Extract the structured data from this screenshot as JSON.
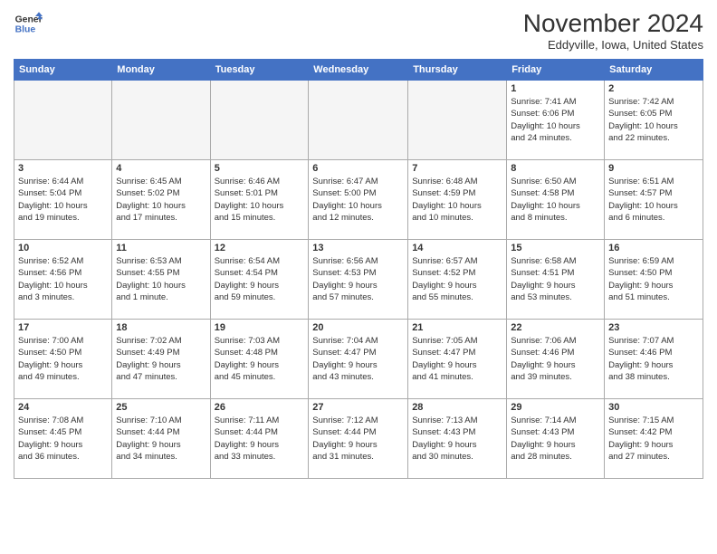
{
  "header": {
    "logo_line1": "General",
    "logo_line2": "Blue",
    "month": "November 2024",
    "location": "Eddyville, Iowa, United States"
  },
  "weekdays": [
    "Sunday",
    "Monday",
    "Tuesday",
    "Wednesday",
    "Thursday",
    "Friday",
    "Saturday"
  ],
  "weeks": [
    [
      {
        "day": "",
        "info": ""
      },
      {
        "day": "",
        "info": ""
      },
      {
        "day": "",
        "info": ""
      },
      {
        "day": "",
        "info": ""
      },
      {
        "day": "",
        "info": ""
      },
      {
        "day": "1",
        "info": "Sunrise: 7:41 AM\nSunset: 6:06 PM\nDaylight: 10 hours\nand 24 minutes."
      },
      {
        "day": "2",
        "info": "Sunrise: 7:42 AM\nSunset: 6:05 PM\nDaylight: 10 hours\nand 22 minutes."
      }
    ],
    [
      {
        "day": "3",
        "info": "Sunrise: 6:44 AM\nSunset: 5:04 PM\nDaylight: 10 hours\nand 19 minutes."
      },
      {
        "day": "4",
        "info": "Sunrise: 6:45 AM\nSunset: 5:02 PM\nDaylight: 10 hours\nand 17 minutes."
      },
      {
        "day": "5",
        "info": "Sunrise: 6:46 AM\nSunset: 5:01 PM\nDaylight: 10 hours\nand 15 minutes."
      },
      {
        "day": "6",
        "info": "Sunrise: 6:47 AM\nSunset: 5:00 PM\nDaylight: 10 hours\nand 12 minutes."
      },
      {
        "day": "7",
        "info": "Sunrise: 6:48 AM\nSunset: 4:59 PM\nDaylight: 10 hours\nand 10 minutes."
      },
      {
        "day": "8",
        "info": "Sunrise: 6:50 AM\nSunset: 4:58 PM\nDaylight: 10 hours\nand 8 minutes."
      },
      {
        "day": "9",
        "info": "Sunrise: 6:51 AM\nSunset: 4:57 PM\nDaylight: 10 hours\nand 6 minutes."
      }
    ],
    [
      {
        "day": "10",
        "info": "Sunrise: 6:52 AM\nSunset: 4:56 PM\nDaylight: 10 hours\nand 3 minutes."
      },
      {
        "day": "11",
        "info": "Sunrise: 6:53 AM\nSunset: 4:55 PM\nDaylight: 10 hours\nand 1 minute."
      },
      {
        "day": "12",
        "info": "Sunrise: 6:54 AM\nSunset: 4:54 PM\nDaylight: 9 hours\nand 59 minutes."
      },
      {
        "day": "13",
        "info": "Sunrise: 6:56 AM\nSunset: 4:53 PM\nDaylight: 9 hours\nand 57 minutes."
      },
      {
        "day": "14",
        "info": "Sunrise: 6:57 AM\nSunset: 4:52 PM\nDaylight: 9 hours\nand 55 minutes."
      },
      {
        "day": "15",
        "info": "Sunrise: 6:58 AM\nSunset: 4:51 PM\nDaylight: 9 hours\nand 53 minutes."
      },
      {
        "day": "16",
        "info": "Sunrise: 6:59 AM\nSunset: 4:50 PM\nDaylight: 9 hours\nand 51 minutes."
      }
    ],
    [
      {
        "day": "17",
        "info": "Sunrise: 7:00 AM\nSunset: 4:50 PM\nDaylight: 9 hours\nand 49 minutes."
      },
      {
        "day": "18",
        "info": "Sunrise: 7:02 AM\nSunset: 4:49 PM\nDaylight: 9 hours\nand 47 minutes."
      },
      {
        "day": "19",
        "info": "Sunrise: 7:03 AM\nSunset: 4:48 PM\nDaylight: 9 hours\nand 45 minutes."
      },
      {
        "day": "20",
        "info": "Sunrise: 7:04 AM\nSunset: 4:47 PM\nDaylight: 9 hours\nand 43 minutes."
      },
      {
        "day": "21",
        "info": "Sunrise: 7:05 AM\nSunset: 4:47 PM\nDaylight: 9 hours\nand 41 minutes."
      },
      {
        "day": "22",
        "info": "Sunrise: 7:06 AM\nSunset: 4:46 PM\nDaylight: 9 hours\nand 39 minutes."
      },
      {
        "day": "23",
        "info": "Sunrise: 7:07 AM\nSunset: 4:46 PM\nDaylight: 9 hours\nand 38 minutes."
      }
    ],
    [
      {
        "day": "24",
        "info": "Sunrise: 7:08 AM\nSunset: 4:45 PM\nDaylight: 9 hours\nand 36 minutes."
      },
      {
        "day": "25",
        "info": "Sunrise: 7:10 AM\nSunset: 4:44 PM\nDaylight: 9 hours\nand 34 minutes."
      },
      {
        "day": "26",
        "info": "Sunrise: 7:11 AM\nSunset: 4:44 PM\nDaylight: 9 hours\nand 33 minutes."
      },
      {
        "day": "27",
        "info": "Sunrise: 7:12 AM\nSunset: 4:44 PM\nDaylight: 9 hours\nand 31 minutes."
      },
      {
        "day": "28",
        "info": "Sunrise: 7:13 AM\nSunset: 4:43 PM\nDaylight: 9 hours\nand 30 minutes."
      },
      {
        "day": "29",
        "info": "Sunrise: 7:14 AM\nSunset: 4:43 PM\nDaylight: 9 hours\nand 28 minutes."
      },
      {
        "day": "30",
        "info": "Sunrise: 7:15 AM\nSunset: 4:42 PM\nDaylight: 9 hours\nand 27 minutes."
      }
    ]
  ]
}
